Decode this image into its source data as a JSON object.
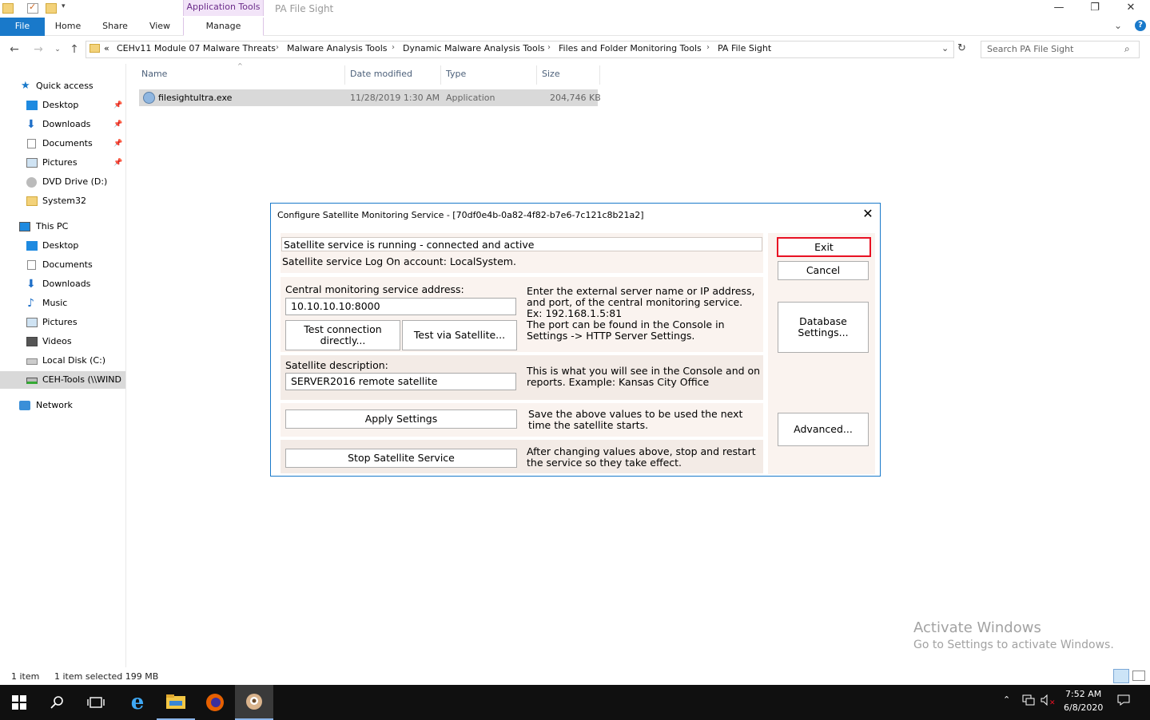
{
  "window": {
    "title": "PA File Sight",
    "context_tab": "Application Tools",
    "min": "—",
    "restore": "❐",
    "close": "✕",
    "help": "?",
    "collapse": "⌄"
  },
  "ribbon": {
    "file": "File",
    "home": "Home",
    "share": "Share",
    "view": "View",
    "manage": "Manage"
  },
  "address": {
    "overflow": "«",
    "crumbs": [
      "CEHv11 Module 07 Malware Threats",
      "Malware Analysis Tools",
      "Dynamic Malware Analysis Tools",
      "Files and Folder Monitoring Tools",
      "PA File Sight"
    ],
    "search_placeholder": "Search PA File Sight"
  },
  "nav": {
    "quick_access": "Quick access",
    "qa_items": [
      "Desktop",
      "Downloads",
      "Documents",
      "Pictures",
      "DVD Drive (D:)",
      "System32"
    ],
    "this_pc": "This PC",
    "pc_items": [
      "Desktop",
      "Documents",
      "Downloads",
      "Music",
      "Pictures",
      "Videos",
      "Local Disk (C:)",
      "CEH-Tools (\\\\WIND"
    ],
    "network": "Network"
  },
  "columns": {
    "name": "Name",
    "date": "Date modified",
    "type": "Type",
    "size": "Size"
  },
  "files": [
    {
      "name": "filesightultra.exe",
      "date": "11/28/2019 1:30 AM",
      "type": "Application",
      "size": "204,746 KB"
    }
  ],
  "dialog": {
    "title": "Configure Satellite Monitoring Service - [70df0e4b-0a82-4f82-b7e6-7c121c8b21a2]",
    "status": "Satellite service is running - connected and active",
    "logon": "Satellite service Log On account: LocalSystem.",
    "address_label": "Central monitoring service address:",
    "address_value": "10.10.10.10:8000",
    "test_direct_1": "Test connection",
    "test_direct_2": "directly...",
    "test_satellite": "Test via Satellite...",
    "address_help": [
      "Enter the external server name or IP address,",
      "and port, of the central monitoring service.",
      "Ex: 192.168.1.5:81",
      "The port can be found in the Console in",
      "Settings -> HTTP Server Settings."
    ],
    "desc_label": "Satellite description:",
    "desc_value": "SERVER2016 remote satellite",
    "desc_help": [
      "This is what you will see in the Console and on",
      "reports.  Example: Kansas City Office"
    ],
    "apply": "Apply Settings",
    "apply_help": [
      "Save the above values to be used the next",
      "time the satellite starts."
    ],
    "stop": "Stop Satellite Service",
    "stop_help": [
      "After changing values above, stop and restart",
      "the service so they take effect."
    ],
    "exit": "Exit",
    "cancel": "Cancel",
    "db_1": "Database",
    "db_2": "Settings...",
    "advanced": "Advanced..."
  },
  "status": {
    "count": "1 item",
    "selected": "1 item selected  199 MB"
  },
  "watermark": {
    "line1": "Activate Windows",
    "line2": "Go to Settings to activate Windows."
  },
  "clock": {
    "time": "7:52 AM",
    "date": "6/8/2020"
  },
  "colors": {
    "accent": "#1979ca",
    "context_tab": "#6b2c8a",
    "highlight": "#e81123"
  }
}
